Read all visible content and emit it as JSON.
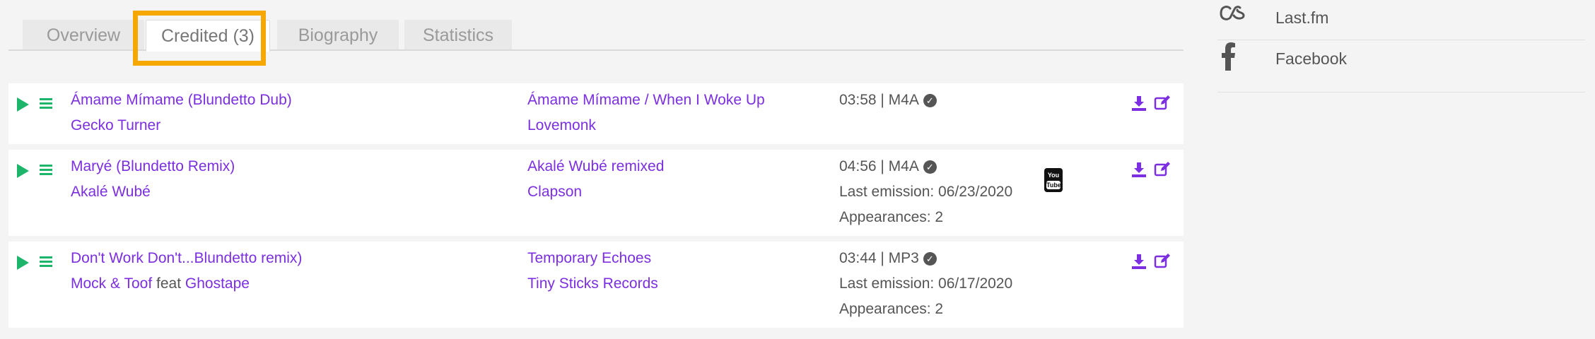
{
  "tabs": [
    {
      "label": "Overview"
    },
    {
      "label": "Credited (3)"
    },
    {
      "label": "Biography"
    },
    {
      "label": "Statistics"
    }
  ],
  "tracks": [
    {
      "title": "Ámame Mímame (Blundetto Dub)",
      "artist": "Gecko Turner",
      "release": "Ámame Mímame / When I Woke Up",
      "label": "Lovemonk",
      "duration_format": "03:58 | M4A",
      "last_emission": "",
      "appearances": ""
    },
    {
      "title": "Maryé (Blundetto Remix)",
      "artist": "Akalé Wubé",
      "release": "Akalé Wubé remixed",
      "label": "Clapson",
      "duration_format": "04:56 | M4A",
      "last_emission": "Last emission: 06/23/2020",
      "appearances": "Appearances: 2"
    },
    {
      "title": "Don't Work Don't...Blundetto remix)",
      "artist": "Mock & Toof",
      "feat_text": "feat",
      "feat_artist": "Ghostape",
      "release": "Temporary Echoes",
      "label": "Tiny Sticks Records",
      "duration_format": "03:44 | MP3",
      "last_emission": "Last emission: 06/17/2020",
      "appearances": "Appearances: 2"
    }
  ],
  "youtube": {
    "top": "You",
    "bottom": "Tube"
  },
  "sidebar": {
    "items": [
      {
        "label": "Last.fm",
        "icon": "lastfm-icon"
      },
      {
        "label": "Facebook",
        "icon": "facebook-icon"
      }
    ]
  },
  "colors": {
    "link": "#7b2fe0",
    "play": "#1db56a",
    "highlight": "#f6a800"
  }
}
